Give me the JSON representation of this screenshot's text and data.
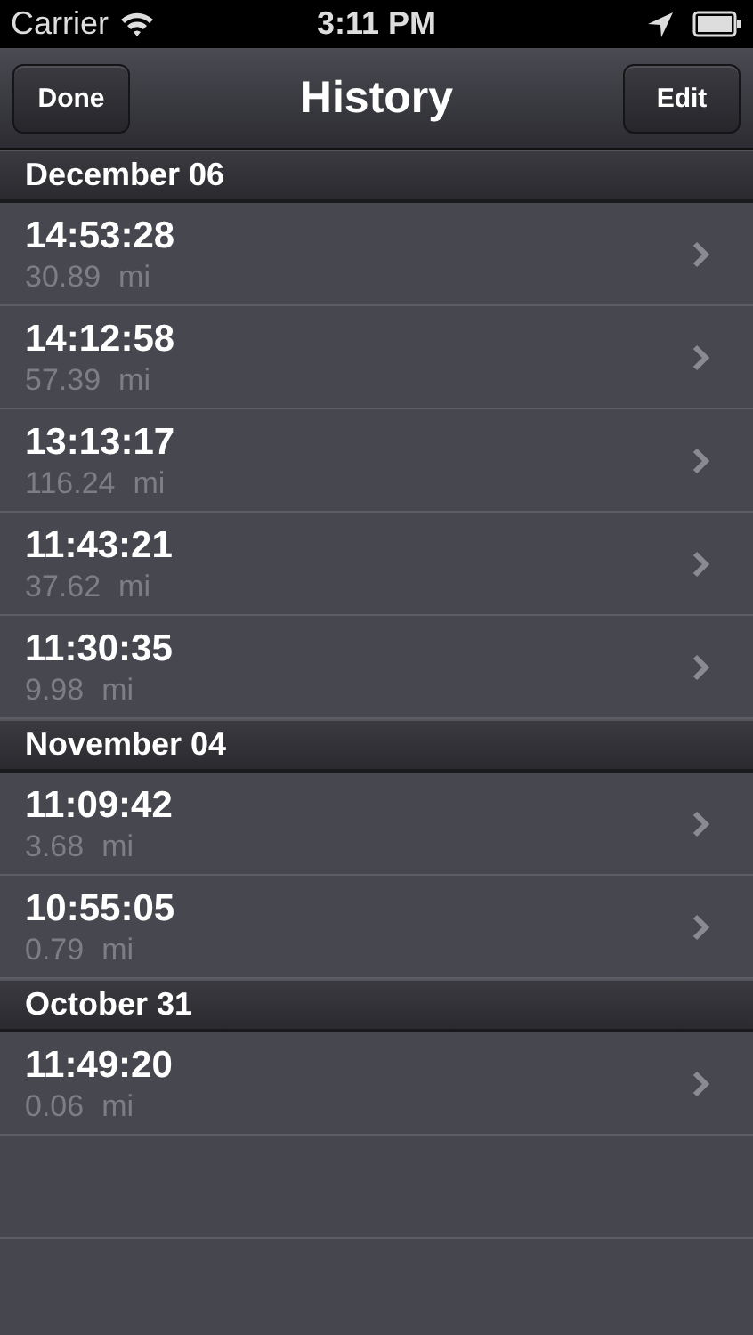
{
  "status_bar": {
    "carrier": "Carrier",
    "time": "3:11 PM"
  },
  "nav_bar": {
    "left_button": "Done",
    "title": "History",
    "right_button": "Edit"
  },
  "sections": [
    {
      "title": "December 06",
      "rows": [
        {
          "time": "14:53:28",
          "distance": "30.89",
          "unit": "mi"
        },
        {
          "time": "14:12:58",
          "distance": "57.39",
          "unit": "mi"
        },
        {
          "time": "13:13:17",
          "distance": "116.24",
          "unit": "mi"
        },
        {
          "time": "11:43:21",
          "distance": "37.62",
          "unit": "mi"
        },
        {
          "time": "11:30:35",
          "distance": "9.98",
          "unit": "mi"
        }
      ]
    },
    {
      "title": "November 04",
      "rows": [
        {
          "time": "11:09:42",
          "distance": "3.68",
          "unit": "mi"
        },
        {
          "time": "10:55:05",
          "distance": "0.79",
          "unit": "mi"
        }
      ]
    },
    {
      "title": "October 31",
      "rows": [
        {
          "time": "11:49:20",
          "distance": "0.06",
          "unit": "mi"
        }
      ]
    }
  ]
}
